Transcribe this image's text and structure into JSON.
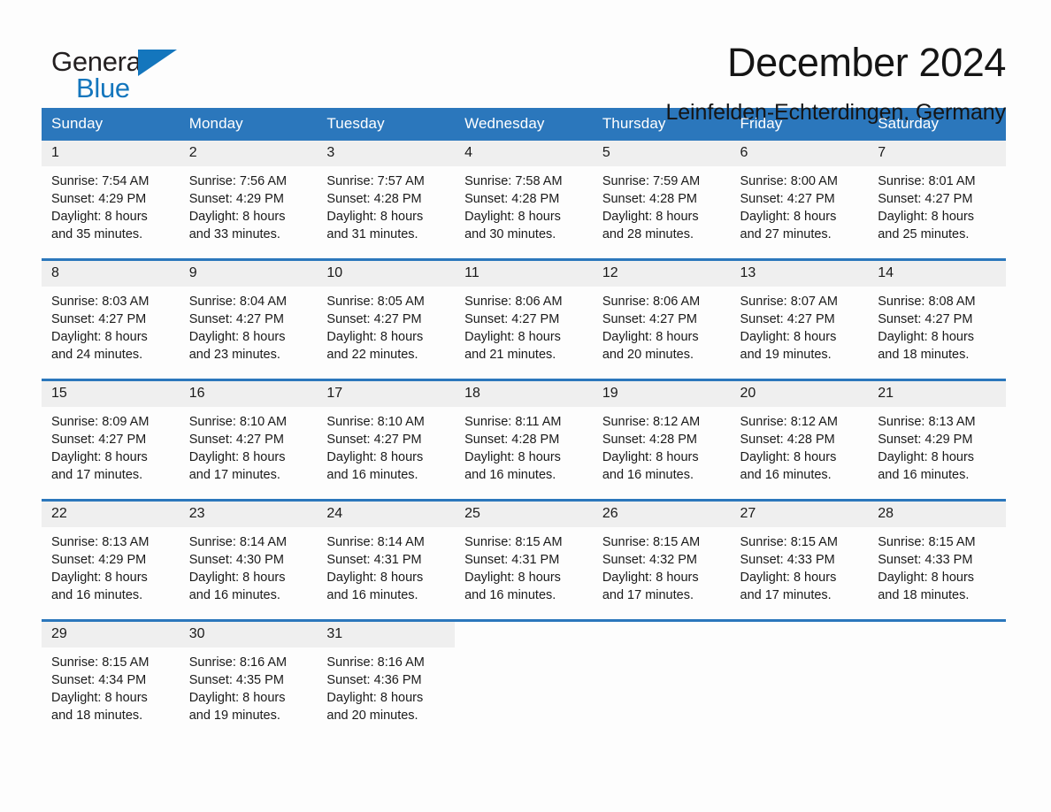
{
  "brand": {
    "name_part1": "General",
    "name_part2": "Blue",
    "flag_icon": "triangle-flag-icon"
  },
  "header": {
    "title": "December 2024",
    "location": "Leinfelden-Echterdingen, Germany"
  },
  "colors": {
    "header_blue": "#2b77bc",
    "brand_blue": "#1476bd",
    "daynum_gray": "#efefef",
    "page_background": "#fdfdfd",
    "text": "#1a1a1a"
  },
  "weekday_headers": [
    "Sunday",
    "Monday",
    "Tuesday",
    "Wednesday",
    "Thursday",
    "Friday",
    "Saturday"
  ],
  "weeks": [
    {
      "days": [
        {
          "date": "1",
          "sunrise": "Sunrise: 7:54 AM",
          "sunset": "Sunset: 4:29 PM",
          "daylight_line1": "Daylight: 8 hours",
          "daylight_line2": "and 35 minutes."
        },
        {
          "date": "2",
          "sunrise": "Sunrise: 7:56 AM",
          "sunset": "Sunset: 4:29 PM",
          "daylight_line1": "Daylight: 8 hours",
          "daylight_line2": "and 33 minutes."
        },
        {
          "date": "3",
          "sunrise": "Sunrise: 7:57 AM",
          "sunset": "Sunset: 4:28 PM",
          "daylight_line1": "Daylight: 8 hours",
          "daylight_line2": "and 31 minutes."
        },
        {
          "date": "4",
          "sunrise": "Sunrise: 7:58 AM",
          "sunset": "Sunset: 4:28 PM",
          "daylight_line1": "Daylight: 8 hours",
          "daylight_line2": "and 30 minutes."
        },
        {
          "date": "5",
          "sunrise": "Sunrise: 7:59 AM",
          "sunset": "Sunset: 4:28 PM",
          "daylight_line1": "Daylight: 8 hours",
          "daylight_line2": "and 28 minutes."
        },
        {
          "date": "6",
          "sunrise": "Sunrise: 8:00 AM",
          "sunset": "Sunset: 4:27 PM",
          "daylight_line1": "Daylight: 8 hours",
          "daylight_line2": "and 27 minutes."
        },
        {
          "date": "7",
          "sunrise": "Sunrise: 8:01 AM",
          "sunset": "Sunset: 4:27 PM",
          "daylight_line1": "Daylight: 8 hours",
          "daylight_line2": "and 25 minutes."
        }
      ]
    },
    {
      "days": [
        {
          "date": "8",
          "sunrise": "Sunrise: 8:03 AM",
          "sunset": "Sunset: 4:27 PM",
          "daylight_line1": "Daylight: 8 hours",
          "daylight_line2": "and 24 minutes."
        },
        {
          "date": "9",
          "sunrise": "Sunrise: 8:04 AM",
          "sunset": "Sunset: 4:27 PM",
          "daylight_line1": "Daylight: 8 hours",
          "daylight_line2": "and 23 minutes."
        },
        {
          "date": "10",
          "sunrise": "Sunrise: 8:05 AM",
          "sunset": "Sunset: 4:27 PM",
          "daylight_line1": "Daylight: 8 hours",
          "daylight_line2": "and 22 minutes."
        },
        {
          "date": "11",
          "sunrise": "Sunrise: 8:06 AM",
          "sunset": "Sunset: 4:27 PM",
          "daylight_line1": "Daylight: 8 hours",
          "daylight_line2": "and 21 minutes."
        },
        {
          "date": "12",
          "sunrise": "Sunrise: 8:06 AM",
          "sunset": "Sunset: 4:27 PM",
          "daylight_line1": "Daylight: 8 hours",
          "daylight_line2": "and 20 minutes."
        },
        {
          "date": "13",
          "sunrise": "Sunrise: 8:07 AM",
          "sunset": "Sunset: 4:27 PM",
          "daylight_line1": "Daylight: 8 hours",
          "daylight_line2": "and 19 minutes."
        },
        {
          "date": "14",
          "sunrise": "Sunrise: 8:08 AM",
          "sunset": "Sunset: 4:27 PM",
          "daylight_line1": "Daylight: 8 hours",
          "daylight_line2": "and 18 minutes."
        }
      ]
    },
    {
      "days": [
        {
          "date": "15",
          "sunrise": "Sunrise: 8:09 AM",
          "sunset": "Sunset: 4:27 PM",
          "daylight_line1": "Daylight: 8 hours",
          "daylight_line2": "and 17 minutes."
        },
        {
          "date": "16",
          "sunrise": "Sunrise: 8:10 AM",
          "sunset": "Sunset: 4:27 PM",
          "daylight_line1": "Daylight: 8 hours",
          "daylight_line2": "and 17 minutes."
        },
        {
          "date": "17",
          "sunrise": "Sunrise: 8:10 AM",
          "sunset": "Sunset: 4:27 PM",
          "daylight_line1": "Daylight: 8 hours",
          "daylight_line2": "and 16 minutes."
        },
        {
          "date": "18",
          "sunrise": "Sunrise: 8:11 AM",
          "sunset": "Sunset: 4:28 PM",
          "daylight_line1": "Daylight: 8 hours",
          "daylight_line2": "and 16 minutes."
        },
        {
          "date": "19",
          "sunrise": "Sunrise: 8:12 AM",
          "sunset": "Sunset: 4:28 PM",
          "daylight_line1": "Daylight: 8 hours",
          "daylight_line2": "and 16 minutes."
        },
        {
          "date": "20",
          "sunrise": "Sunrise: 8:12 AM",
          "sunset": "Sunset: 4:28 PM",
          "daylight_line1": "Daylight: 8 hours",
          "daylight_line2": "and 16 minutes."
        },
        {
          "date": "21",
          "sunrise": "Sunrise: 8:13 AM",
          "sunset": "Sunset: 4:29 PM",
          "daylight_line1": "Daylight: 8 hours",
          "daylight_line2": "and 16 minutes."
        }
      ]
    },
    {
      "days": [
        {
          "date": "22",
          "sunrise": "Sunrise: 8:13 AM",
          "sunset": "Sunset: 4:29 PM",
          "daylight_line1": "Daylight: 8 hours",
          "daylight_line2": "and 16 minutes."
        },
        {
          "date": "23",
          "sunrise": "Sunrise: 8:14 AM",
          "sunset": "Sunset: 4:30 PM",
          "daylight_line1": "Daylight: 8 hours",
          "daylight_line2": "and 16 minutes."
        },
        {
          "date": "24",
          "sunrise": "Sunrise: 8:14 AM",
          "sunset": "Sunset: 4:31 PM",
          "daylight_line1": "Daylight: 8 hours",
          "daylight_line2": "and 16 minutes."
        },
        {
          "date": "25",
          "sunrise": "Sunrise: 8:15 AM",
          "sunset": "Sunset: 4:31 PM",
          "daylight_line1": "Daylight: 8 hours",
          "daylight_line2": "and 16 minutes."
        },
        {
          "date": "26",
          "sunrise": "Sunrise: 8:15 AM",
          "sunset": "Sunset: 4:32 PM",
          "daylight_line1": "Daylight: 8 hours",
          "daylight_line2": "and 17 minutes."
        },
        {
          "date": "27",
          "sunrise": "Sunrise: 8:15 AM",
          "sunset": "Sunset: 4:33 PM",
          "daylight_line1": "Daylight: 8 hours",
          "daylight_line2": "and 17 minutes."
        },
        {
          "date": "28",
          "sunrise": "Sunrise: 8:15 AM",
          "sunset": "Sunset: 4:33 PM",
          "daylight_line1": "Daylight: 8 hours",
          "daylight_line2": "and 18 minutes."
        }
      ]
    },
    {
      "days": [
        {
          "date": "29",
          "sunrise": "Sunrise: 8:15 AM",
          "sunset": "Sunset: 4:34 PM",
          "daylight_line1": "Daylight: 8 hours",
          "daylight_line2": "and 18 minutes."
        },
        {
          "date": "30",
          "sunrise": "Sunrise: 8:16 AM",
          "sunset": "Sunset: 4:35 PM",
          "daylight_line1": "Daylight: 8 hours",
          "daylight_line2": "and 19 minutes."
        },
        {
          "date": "31",
          "sunrise": "Sunrise: 8:16 AM",
          "sunset": "Sunset: 4:36 PM",
          "daylight_line1": "Daylight: 8 hours",
          "daylight_line2": "and 20 minutes."
        },
        {
          "date": "",
          "sunrise": "",
          "sunset": "",
          "daylight_line1": "",
          "daylight_line2": "",
          "empty": true
        },
        {
          "date": "",
          "sunrise": "",
          "sunset": "",
          "daylight_line1": "",
          "daylight_line2": "",
          "empty": true
        },
        {
          "date": "",
          "sunrise": "",
          "sunset": "",
          "daylight_line1": "",
          "daylight_line2": "",
          "empty": true
        },
        {
          "date": "",
          "sunrise": "",
          "sunset": "",
          "daylight_line1": "",
          "daylight_line2": "",
          "empty": true
        }
      ]
    }
  ]
}
